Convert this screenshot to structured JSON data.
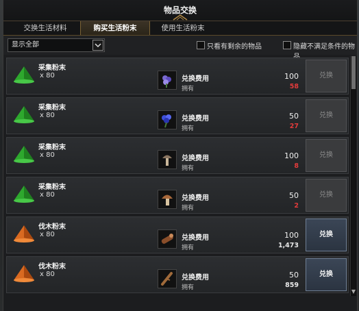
{
  "window": {
    "title": "物品交换"
  },
  "tabs": [
    {
      "label": "交换生活材料",
      "active": false
    },
    {
      "label": "购买生活粉末",
      "active": true
    },
    {
      "label": "使用生活粉末",
      "active": false
    }
  ],
  "filter": {
    "dropdown_value": "显示全部",
    "checkbox1_label": "只看有剩余的物品",
    "checkbox2_label": "隐藏不满足条件的物品"
  },
  "items": [
    {
      "name": "采集粉末",
      "qty": "x 80",
      "cost_label": "兑换费用",
      "own_label": "拥有",
      "cost": "100",
      "own": "58",
      "own_color": "red",
      "button": "兑换",
      "enabled": false,
      "item_icon": "green-powder-icon",
      "cost_icon": "purple-flower-icon"
    },
    {
      "name": "采集粉末",
      "qty": "x 80",
      "cost_label": "兑换费用",
      "own_label": "拥有",
      "cost": "50",
      "own": "27",
      "own_color": "red",
      "button": "兑换",
      "enabled": false,
      "item_icon": "green-powder-icon",
      "cost_icon": "blue-flower-icon"
    },
    {
      "name": "采集粉末",
      "qty": "x 80",
      "cost_label": "兑换费用",
      "own_label": "拥有",
      "cost": "100",
      "own": "8",
      "own_color": "red",
      "button": "兑换",
      "enabled": false,
      "item_icon": "green-powder-icon",
      "cost_icon": "mushroom-icon"
    },
    {
      "name": "采集粉末",
      "qty": "x 80",
      "cost_label": "兑换费用",
      "own_label": "拥有",
      "cost": "50",
      "own": "2",
      "own_color": "red",
      "button": "兑换",
      "enabled": false,
      "item_icon": "green-powder-icon",
      "cost_icon": "brown-mushroom-icon"
    },
    {
      "name": "伐木粉末",
      "qty": "x 80",
      "cost_label": "兑换费用",
      "own_label": "拥有",
      "cost": "100",
      "own": "1,473",
      "own_color": "white",
      "button": "兑换",
      "enabled": true,
      "item_icon": "orange-powder-icon",
      "cost_icon": "wood-log-icon"
    },
    {
      "name": "伐木粉末",
      "qty": "x 80",
      "cost_label": "兑换费用",
      "own_label": "拥有",
      "cost": "50",
      "own": "859",
      "own_color": "white",
      "button": "兑换",
      "enabled": true,
      "item_icon": "orange-powder-icon",
      "cost_icon": "wood-branch-icon"
    }
  ],
  "colors": {
    "accent": "#7a6235",
    "red": "#e23b3b",
    "green_powder": "#2ea82e",
    "orange_powder": "#d96a21"
  }
}
